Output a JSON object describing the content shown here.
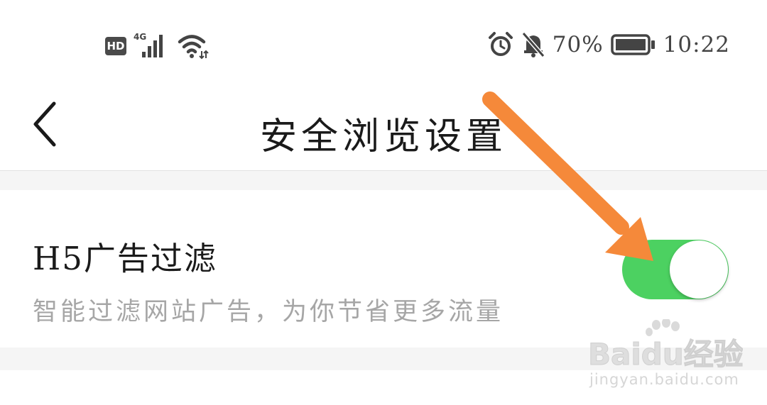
{
  "status_bar": {
    "hd_label": "HD",
    "network_label": "4G",
    "battery_percent": "70%",
    "battery_level": 0.7,
    "time": "10:22",
    "icons": [
      "signal-icon",
      "wifi-icon",
      "alarm-icon",
      "notifications-muted-icon",
      "battery-icon"
    ]
  },
  "nav": {
    "back_icon": "chevron-left-icon",
    "title": "安全浏览设置"
  },
  "setting": {
    "title": "H5广告过滤",
    "description": "智能过滤网站广告，为你节省更多流量",
    "enabled": true,
    "toggle_color": "#4cd161"
  },
  "annotation": {
    "arrow_color": "#f5893a"
  },
  "watermark": {
    "logo_text": "Baidu经验",
    "url": "jingyan.baidu.com"
  }
}
